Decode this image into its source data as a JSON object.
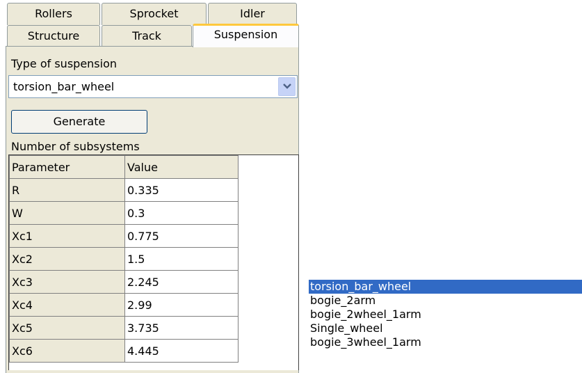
{
  "tabs": {
    "row1": [
      "Rollers",
      "Sprocket",
      "Idler"
    ],
    "row2": [
      "Structure",
      "Track",
      "Suspension"
    ],
    "active": "Suspension"
  },
  "suspension": {
    "type_label": "Type of suspension",
    "type_value": "torsion_bar_wheel",
    "generate_label": "Generate",
    "subsystems_label": "Number of subsystems"
  },
  "grid": {
    "headers": [
      "Parameter",
      "Value"
    ],
    "rows": [
      [
        "R",
        "0.335"
      ],
      [
        "W",
        "0.3"
      ],
      [
        "Xc1",
        "0.775"
      ],
      [
        "Xc2",
        "1.5"
      ],
      [
        "Xc3",
        "2.245"
      ],
      [
        "Xc4",
        "2.99"
      ],
      [
        "Xc5",
        "3.735"
      ],
      [
        "Xc6",
        "4.445"
      ]
    ]
  },
  "dropdown_options": [
    "torsion_bar_wheel",
    "bogie_2arm",
    "bogie_2wheel_1arm",
    "Single_wheel",
    "bogie_3wheel_1arm"
  ],
  "selected_option": "torsion_bar_wheel",
  "icons": {
    "combo_arrow": "chevron-down-icon"
  },
  "colors": {
    "selection": "#316ac5",
    "active_tab_accent": "#ffc83c",
    "panel": "#ece9d8"
  }
}
